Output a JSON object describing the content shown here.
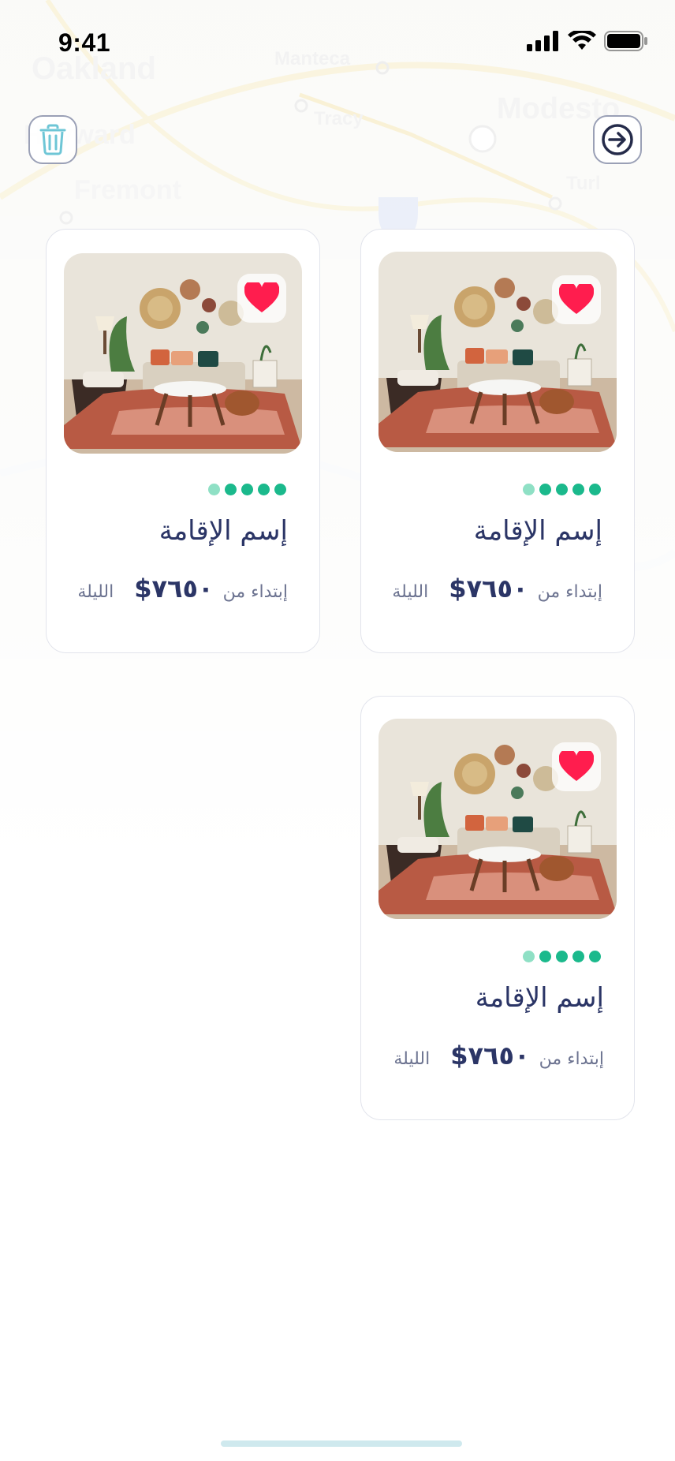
{
  "status_bar": {
    "time": "9:41"
  },
  "map": {
    "place_labels": [
      "Oakland",
      "Manteca",
      "Modesto",
      "Tracy",
      "Hayward",
      "Fremont",
      "Turl"
    ]
  },
  "header": {
    "trash_icon": "trash-icon",
    "forward_icon": "arrow-right-circle-icon"
  },
  "colors": {
    "accent": "#1bb98c",
    "title": "#2b3566",
    "muted": "#6d7491",
    "heart": "#ff1d4e"
  },
  "listings": [
    {
      "name": "إسم الإقامة",
      "from_label": "إبتداء من",
      "price": "$٧٦٥٠",
      "night_label": "الليلة",
      "rating_dots": 5,
      "favorited": true
    },
    {
      "name": "إسم الإقامة",
      "from_label": "إبتداء من",
      "price": "$٧٦٥٠",
      "night_label": "الليلة",
      "rating_dots": 5,
      "favorited": true
    },
    {
      "name": "إسم الإقامة",
      "from_label": "إبتداء من",
      "price": "$٧٦٥٠",
      "night_label": "الليلة",
      "rating_dots": 5,
      "favorited": true
    }
  ]
}
